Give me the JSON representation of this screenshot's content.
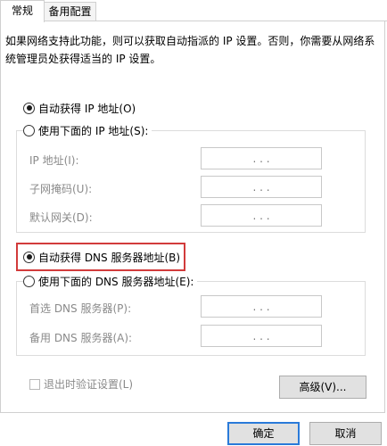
{
  "tabs": [
    {
      "label": "常规"
    },
    {
      "label": "备用配置"
    }
  ],
  "description": "如果网络支持此功能，则可以获取自动指派的 IP 设置。否则，你需要从网络系统管理员处获得适当的 IP 设置。",
  "ip": {
    "auto_label": "自动获得 IP 地址(O)",
    "manual_label": "使用下面的 IP 地址(S):",
    "fields": [
      {
        "label": "IP 地址(I):",
        "value": ".  .  ."
      },
      {
        "label": "子网掩码(U):",
        "value": ".  .  ."
      },
      {
        "label": "默认网关(D):",
        "value": ".  .  ."
      }
    ]
  },
  "dns": {
    "auto_label": "自动获得 DNS 服务器地址(B)",
    "manual_label": "使用下面的 DNS 服务器地址(E):",
    "fields": [
      {
        "label": "首选 DNS 服务器(P):",
        "value": ".  .  ."
      },
      {
        "label": "备用 DNS 服务器(A):",
        "value": ".  .  ."
      }
    ]
  },
  "validate_label": "退出时验证设置(L)",
  "buttons": {
    "advanced": "高级(V)...",
    "ok": "确定",
    "cancel": "取消"
  },
  "colors": {
    "highlight": "#d23b3b",
    "ok_border": "#2a7ad9"
  }
}
